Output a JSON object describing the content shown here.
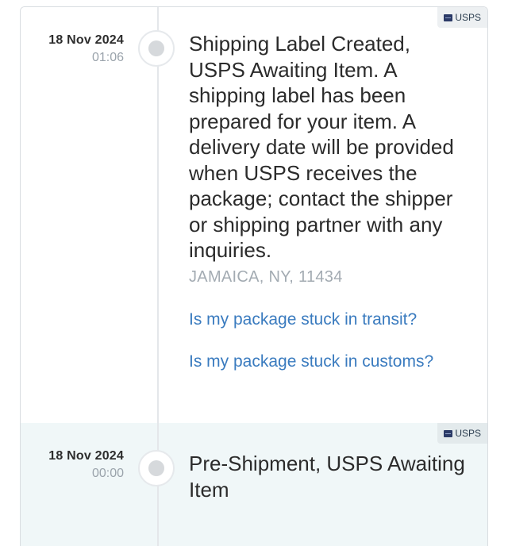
{
  "events": [
    {
      "carrier": "USPS",
      "date": "18 Nov 2024",
      "time": "01:06",
      "status": "Shipping Label Created, USPS Awaiting Item. A shipping label has been prepared for your item. A delivery date will be provided when USPS receives the package; contact the shipper or shipping partner with any inquiries.",
      "location": "JAMAICA, NY, 11434",
      "links": [
        "Is my package stuck in transit?",
        "Is my package stuck in customs?"
      ]
    },
    {
      "carrier": "USPS",
      "date": "18 Nov 2024",
      "time": "00:00",
      "status": "Pre-Shipment, USPS Awaiting Item"
    }
  ],
  "icons": {
    "carrier_logo": "usps-logo-icon",
    "timeline_node": "timeline-node-icon"
  },
  "colors": {
    "link": "#3a7bbf",
    "muted_text": "#9aa3ab",
    "highlight_row": "#f0f7f8"
  }
}
